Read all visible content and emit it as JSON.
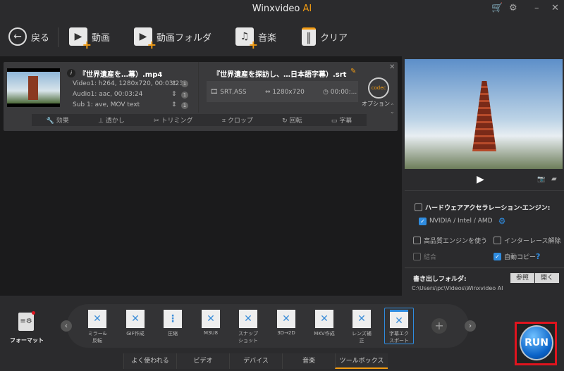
{
  "window": {
    "title": "Winxvideo",
    "title_accent": "AI"
  },
  "toolbar": {
    "back": "戻る",
    "video": "動画",
    "video_folder": "動画フォルダ",
    "music": "音楽",
    "clear": "クリア"
  },
  "file": {
    "source_name": "『世界遺産を…幕）.mp4",
    "video": "Video1: h264, 1280x720, 00:03:23",
    "audio": "Audio1: aac, 00:03:24",
    "sub": "Sub 1: ave, MOV text",
    "track_count": "1",
    "output_name": "『世界遺産を探訪し、…日本語字幕）.srt",
    "format": "SRT,ASS",
    "resolution": "1280x720",
    "duration": "00:00:...",
    "codec_label": "codec",
    "option": "オプション"
  },
  "edit_bar": [
    "効果",
    "透かし",
    "トリミング",
    "クロップ",
    "回転",
    "字幕"
  ],
  "settings": {
    "hw_accel": "ハードウェアアクセラレーション·エンジン:",
    "nvidia": "NVIDIA / Intel / AMD",
    "high_quality": "高品質エンジンを使う",
    "deinterlace": "インターレース解除",
    "merge": "結合",
    "auto_copy": "自動コピー",
    "help": "?"
  },
  "output": {
    "label": "書き出しフォルダ:",
    "path": "C:\\Users\\pc\\Videos\\Winxvideo AI",
    "browse": "参照",
    "open": "開く"
  },
  "format_label": "フォーマット",
  "tools": [
    "ミラー&\n反転",
    "GIF作成",
    "圧縮",
    "M3U8",
    "スナップ\nショット",
    "3D→2D",
    "MKV作成",
    "レンズ補\n正",
    "字幕エク\nスポート"
  ],
  "tabs": [
    "よく使われる",
    "ビデオ",
    "デバイス",
    "音楽",
    "ツールボックス"
  ],
  "run": "RUN",
  "colors": {
    "accent": "#f39c12",
    "blue": "#2f8ce0",
    "highlight": "#e0141e"
  }
}
